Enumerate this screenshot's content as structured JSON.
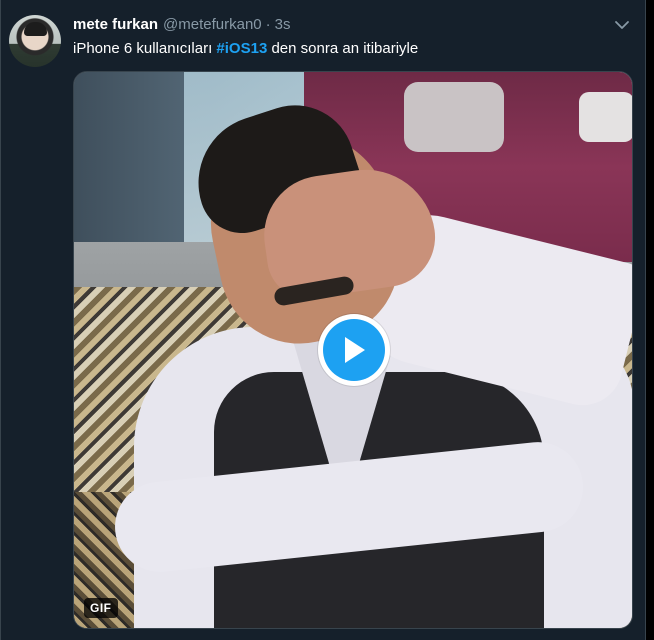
{
  "tweet": {
    "author_name": "mete furkan",
    "author_handle": "@metefurkan0",
    "separator": "·",
    "time": "3s",
    "text_before": "iPhone 6 kullanıcıları ",
    "hashtag": "#iOS13",
    "text_after": " den sonra an itibariyle"
  },
  "media": {
    "badge": "GIF",
    "play_icon": "play-icon"
  },
  "colors": {
    "background": "#15202b",
    "accent": "#1da1f2",
    "secondary_text": "#8899a6"
  }
}
